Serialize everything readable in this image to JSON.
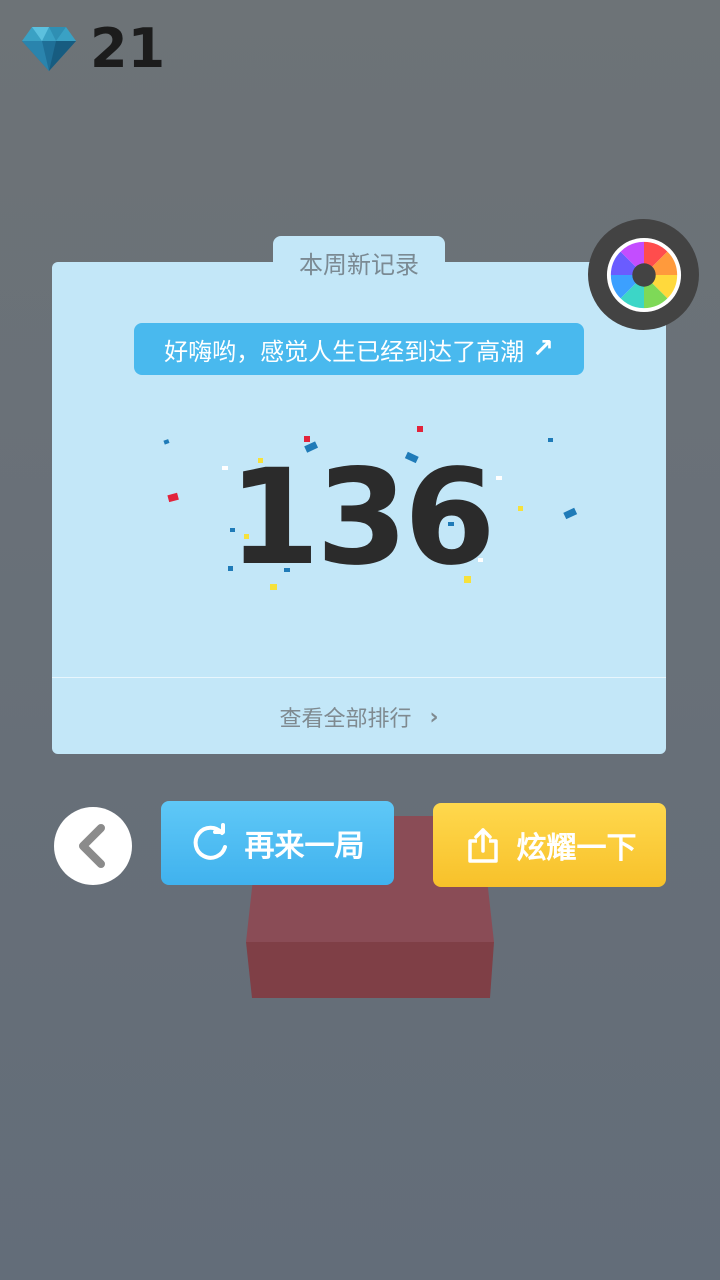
{
  "hud": {
    "gem_icon": "diamond-icon",
    "gem_count": "21"
  },
  "card": {
    "tab_label": "本周新记录",
    "banner_text": "好嗨哟，感觉人生已经到达了高潮",
    "banner_icon": "arrow-up-right-icon",
    "score": "136",
    "ranking_link": "查看全部排行",
    "ranking_chevron": "›"
  },
  "buttons": {
    "back_icon": "chevron-left-icon",
    "camera_icon": "camera-shutter-icon",
    "replay_label": "再来一局",
    "replay_icon": "refresh-icon",
    "share_label": "炫耀一下",
    "share_icon": "share-icon"
  },
  "colors": {
    "background": "#6a7177",
    "card": "#c3e7f8",
    "banner": "#49b9ee",
    "replay": "#4fbdf3",
    "share": "#fbcf3c",
    "score_text": "#2b2b2b"
  }
}
